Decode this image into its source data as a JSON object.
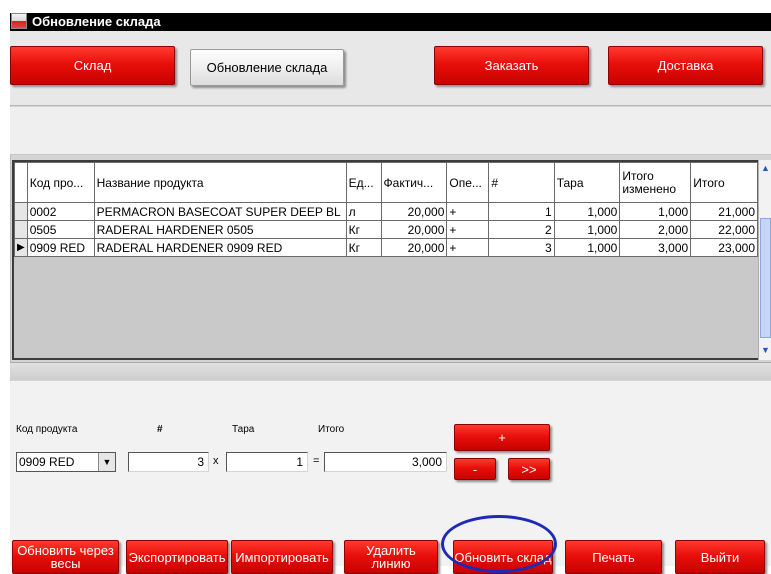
{
  "window": {
    "title": "Обновление склада"
  },
  "top_buttons": {
    "warehouse": "Склад",
    "update_warehouse": "Обновление склада",
    "order": "Заказать",
    "delivery": "Доставка"
  },
  "grid": {
    "columns": [
      "Код про...",
      "Название продукта",
      "Ед...",
      "Фактич...",
      "Опе...",
      "#",
      "Тара",
      "Итого изменено",
      "Итого"
    ],
    "rows": [
      {
        "code": "0002",
        "name": "PERMACRON BASECOAT SUPER DEEP BL",
        "unit": "л",
        "actual": "20,000",
        "op": "+",
        "num": "1",
        "tara": "1,000",
        "changed": "1,000",
        "total": "21,000"
      },
      {
        "code": "0505",
        "name": "RADERAL HARDENER 0505",
        "unit": "Кг",
        "actual": "20,000",
        "op": "+",
        "num": "2",
        "tara": "1,000",
        "changed": "2,000",
        "total": "22,000"
      },
      {
        "code": "0909 RED",
        "name": "RADERAL HARDENER 0909 RED",
        "unit": "Кг",
        "actual": "20,000",
        "op": "+",
        "num": "3",
        "tara": "1,000",
        "changed": "3,000",
        "total": "23,000"
      }
    ]
  },
  "form": {
    "product_code_label": "Код продукта",
    "num_label": "#",
    "tara_label": "Тара",
    "total_label": "Итого",
    "product_code_value": "0909 RED",
    "num_value": "3",
    "tara_value": "1",
    "total_value": "3,000",
    "mult_sign": "x",
    "eq_sign": "=",
    "plus_label": "+",
    "minus_label": "-",
    "next_label": ">>"
  },
  "bottom_buttons": {
    "update_by_scales": "Обновить через весы",
    "export": "Экспортировать",
    "import": "Импортировать",
    "delete_line": "Удалить линию",
    "update_warehouse": "Обновить склад",
    "print": "Печать",
    "exit": "Выйти"
  },
  "colors": {
    "accent_red": "#e80f0a",
    "highlight_circle": "#1e2ab6",
    "title_bar": "#000000"
  }
}
